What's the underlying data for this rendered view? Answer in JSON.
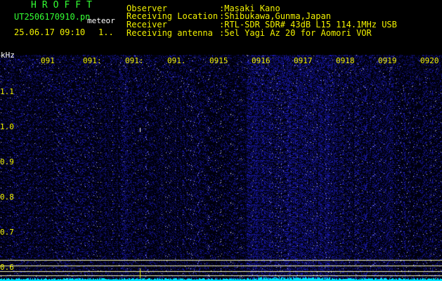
{
  "header": {
    "brand": "HROFFT",
    "filename": "UT2506170910.pn",
    "file_type": "meteor",
    "timestamp": "25.06.17 09:10",
    "marker": "1..",
    "info": [
      {
        "label": "Observer",
        "value": ":Masaki Kano"
      },
      {
        "label": "Receiving Location",
        "value": ":Shibukawa,Gunma,Japan"
      },
      {
        "label": "Receiver",
        "value": ":RTL-SDR SDR# 43dB L15 114.1MHz USB"
      },
      {
        "label": "Receiving antenna",
        "value": ":5el Yagi Az 20 for Aomori VOR"
      }
    ]
  },
  "axes": {
    "unit": "kHz",
    "time_ticks": [
      "091",
      "091:",
      "091:",
      "091.",
      "0915",
      "0916",
      "0917",
      "0918",
      "0919",
      "0920"
    ],
    "freq_ticks": [
      "1.1",
      "1.0",
      "0.9",
      "0.8",
      "0.7",
      "0.6"
    ]
  },
  "colors": {
    "background": "#000000",
    "label_yellow": "#f2f200",
    "brand_green": "#33ff33",
    "noise_blue": "#1a1aff",
    "trace_cyan": "#00e5ff"
  }
}
